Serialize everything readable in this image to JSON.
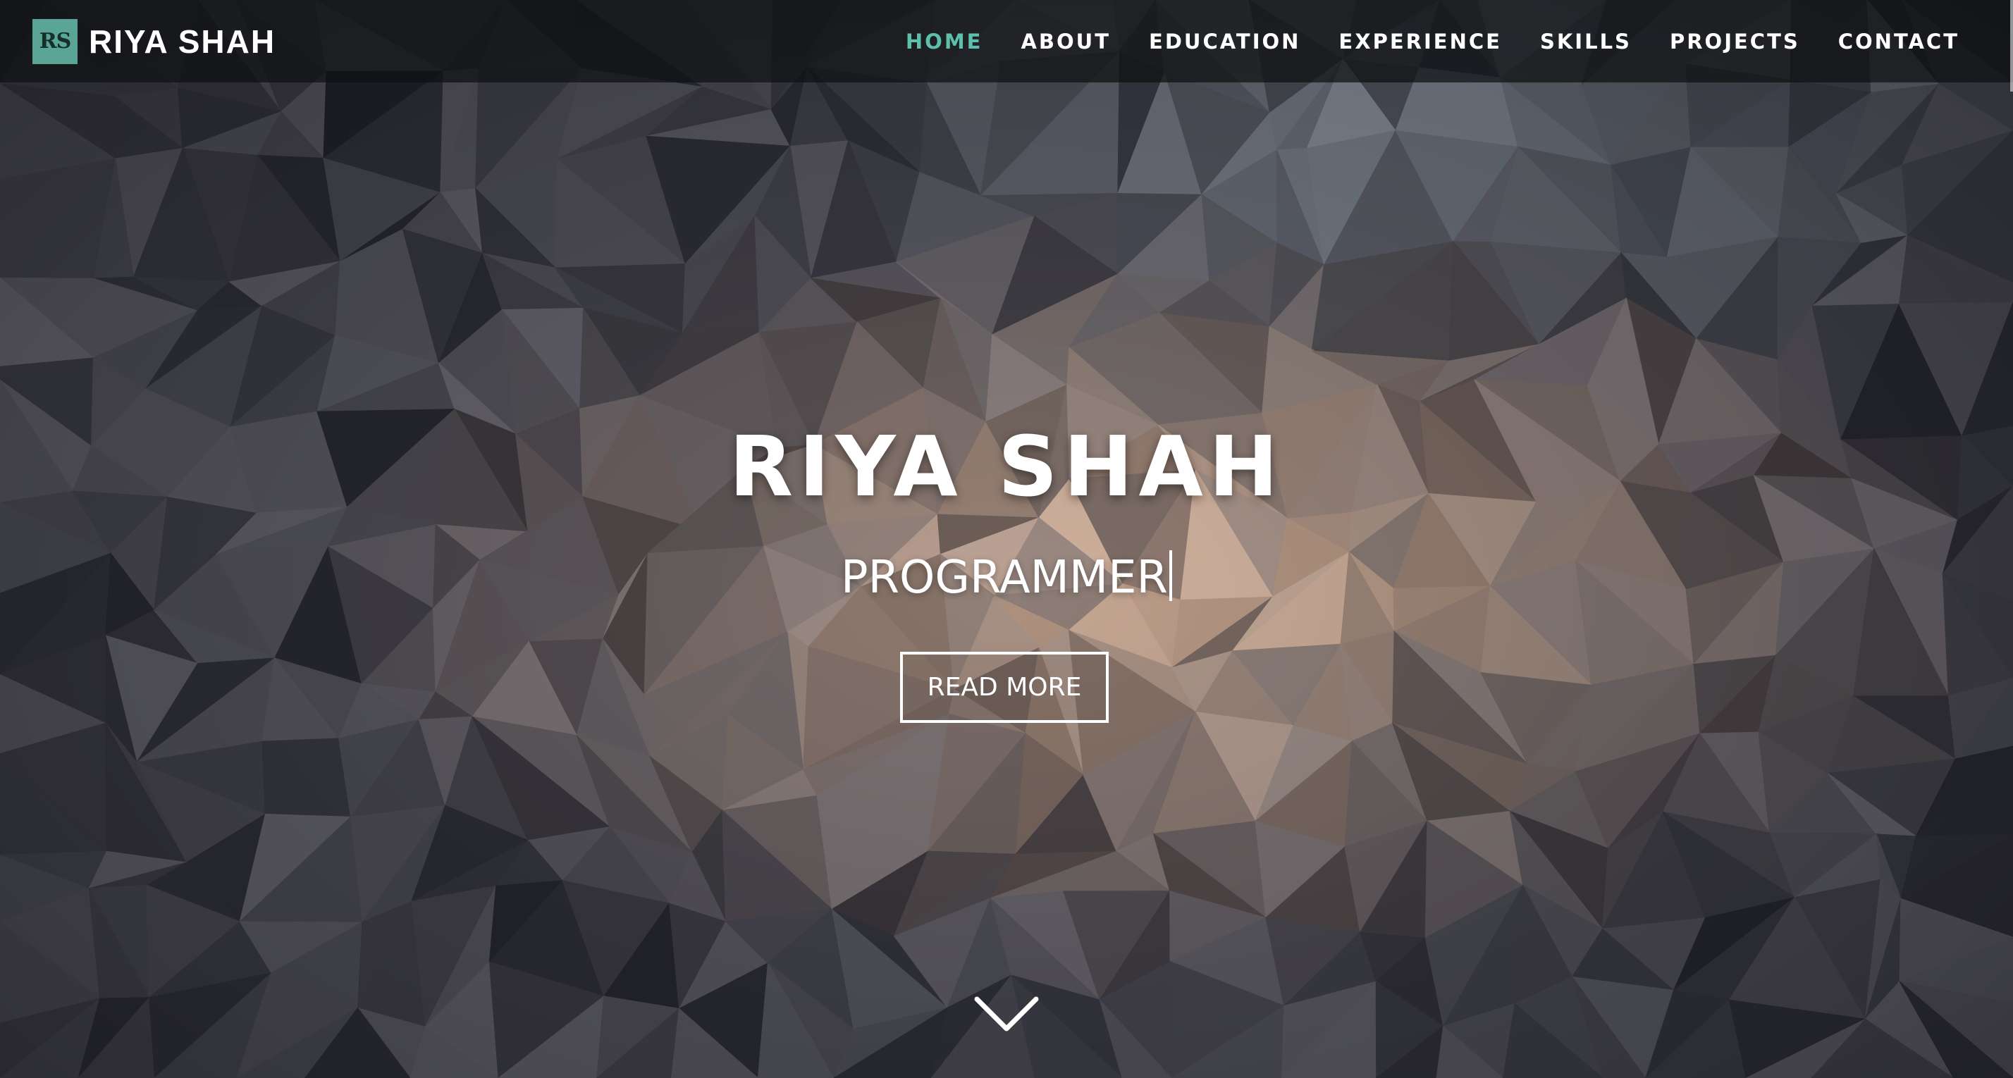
{
  "brand": {
    "logo_text": "RS",
    "name": "RIYA SHAH"
  },
  "nav": {
    "items": [
      {
        "label": "HOME",
        "active": true
      },
      {
        "label": "ABOUT",
        "active": false
      },
      {
        "label": "EDUCATION",
        "active": false
      },
      {
        "label": "EXPERIENCE",
        "active": false
      },
      {
        "label": "SKILLS",
        "active": false
      },
      {
        "label": "PROJECTS",
        "active": false
      },
      {
        "label": "CONTACT",
        "active": false
      }
    ]
  },
  "hero": {
    "title": "RIYA SHAH",
    "subtitle": "PROGRAMMER",
    "button_label": "READ MORE",
    "scroll_icon": "chevron-down-icon"
  },
  "colors": {
    "accent": "#5cc0ad",
    "logo_bg": "#5aa596",
    "nav_bg": "rgba(14,16,18,0.72)",
    "text": "#ffffff"
  }
}
